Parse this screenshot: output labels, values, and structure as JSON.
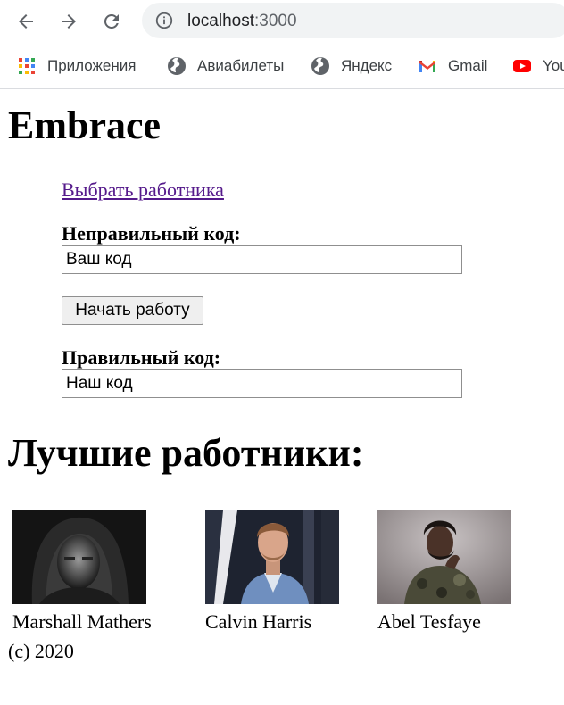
{
  "browser": {
    "url_host": "localhost",
    "url_port": ":3000",
    "bookmarks": [
      {
        "label": "Приложения",
        "icon": "apps-grid-icon"
      },
      {
        "label": "Авиабилеты",
        "icon": "globe-icon"
      },
      {
        "label": "Яндекс",
        "icon": "globe-icon"
      },
      {
        "label": "Gmail",
        "icon": "gmail-icon"
      },
      {
        "label": "YouTube",
        "icon": "youtube-icon"
      }
    ]
  },
  "page": {
    "title": "Embrace",
    "choose_worker_link": "Выбрать работника",
    "wrong_code_label": "Неправильный код:",
    "wrong_code_value": "Ваш код",
    "start_button": "Начать работу",
    "right_code_label": "Правильный код:",
    "right_code_value": "Наш код",
    "best_workers_heading": "Лучшие работники:",
    "workers": [
      {
        "name": "Marshall Mathers"
      },
      {
        "name": "Calvin Harris"
      },
      {
        "name": "Abel Tesfaye"
      }
    ],
    "footer": "(c) 2020"
  }
}
